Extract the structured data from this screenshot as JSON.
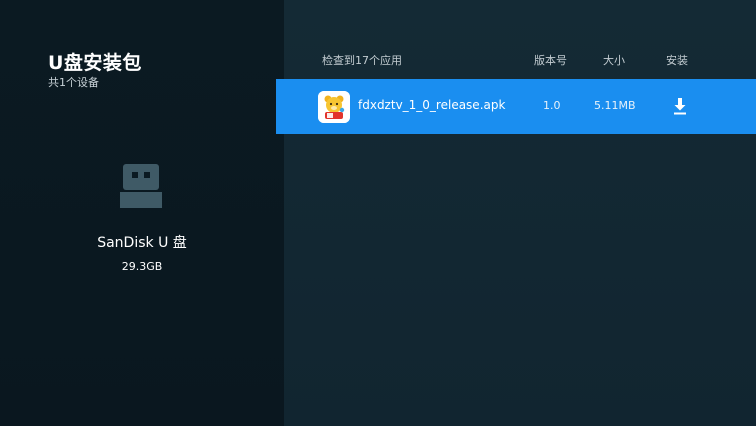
{
  "sidebar": {
    "title": "U盘安装包",
    "subtitle": "共1个设备",
    "device": {
      "icon": "usb-drive-icon",
      "name": "SanDisk U 盘",
      "capacity": "29.3GB"
    }
  },
  "list": {
    "headers": {
      "count": "检查到17个应用",
      "version": "版本号",
      "size": "大小",
      "install": "安装"
    },
    "items": [
      {
        "icon": "app-icon-bear",
        "name": "fdxdztv_1_0_release.apk",
        "version": "1.0",
        "size": "5.11MB",
        "install_icon": "download-icon"
      }
    ]
  },
  "colors": {
    "left_bg": "#0b1a22",
    "right_bg": "#142a35",
    "selected_row": "#1a8ef0"
  }
}
